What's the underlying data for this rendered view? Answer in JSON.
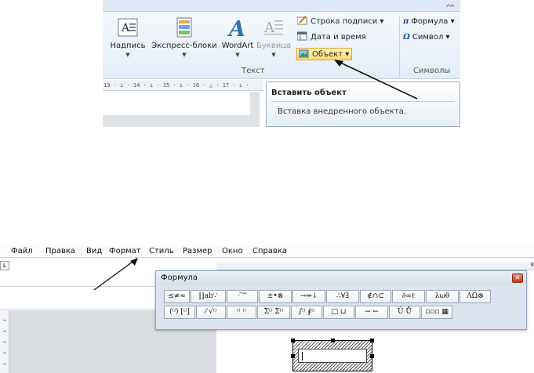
{
  "ribbon": {
    "buttons": {
      "textbox": "Надпись",
      "quickparts": "Экспресс-блоки",
      "wordart": "WordArt",
      "dropcap": "Буквица"
    },
    "small": {
      "signature_line": "Строка подписи",
      "date_time": "Дата и время",
      "object": "Объект",
      "formula": "Формула",
      "symbol": "Символ"
    },
    "groups": {
      "text": "Текст",
      "symbols": "Символы"
    },
    "ruler_text": "13 · ı · 14 · ı · 15 · ı · 16 · △ · 17 · ı ·",
    "tooltip": {
      "title": "Вставить объект",
      "description": "Вставка внедренного объекта."
    },
    "icons": {
      "pi": "π",
      "omega": "Ω",
      "expand": "ᨓ"
    }
  },
  "editor": {
    "menu": [
      "Файл",
      "Правка",
      "Вид",
      "Формат",
      "Стиль",
      "Размер",
      "Окно",
      "Справка"
    ],
    "ruler_end": "8",
    "palette": {
      "title": "Формула",
      "close": "✕",
      "row1": [
        "≤≠≈",
        "∐ab∵",
        "⋅ ̈ ⃗ ⃗",
        "±•⊗",
        "→⇔↓",
        "∴∀∃",
        "∉∩⊂",
        "∂∞ℓ",
        "λωθ",
        "ΛΩ⊗"
      ],
      "row2": [
        "(⁽⁾) [⁽⁾]",
        "⁄ √⁽⁾",
        "⁽⁾ ⁽⁾",
        "Σ⁽⁾ Σ⁽⁾",
        "∫⁽⁾ ∮⁽⁾",
        "□ ⊔",
        "→ ←",
        "Ū Ů",
        "▫▫▫ ▦"
      ]
    },
    "left_ruler_box": "L"
  },
  "colors": {
    "accent": "#1b4fa0",
    "highlight": "#ffd96a"
  }
}
